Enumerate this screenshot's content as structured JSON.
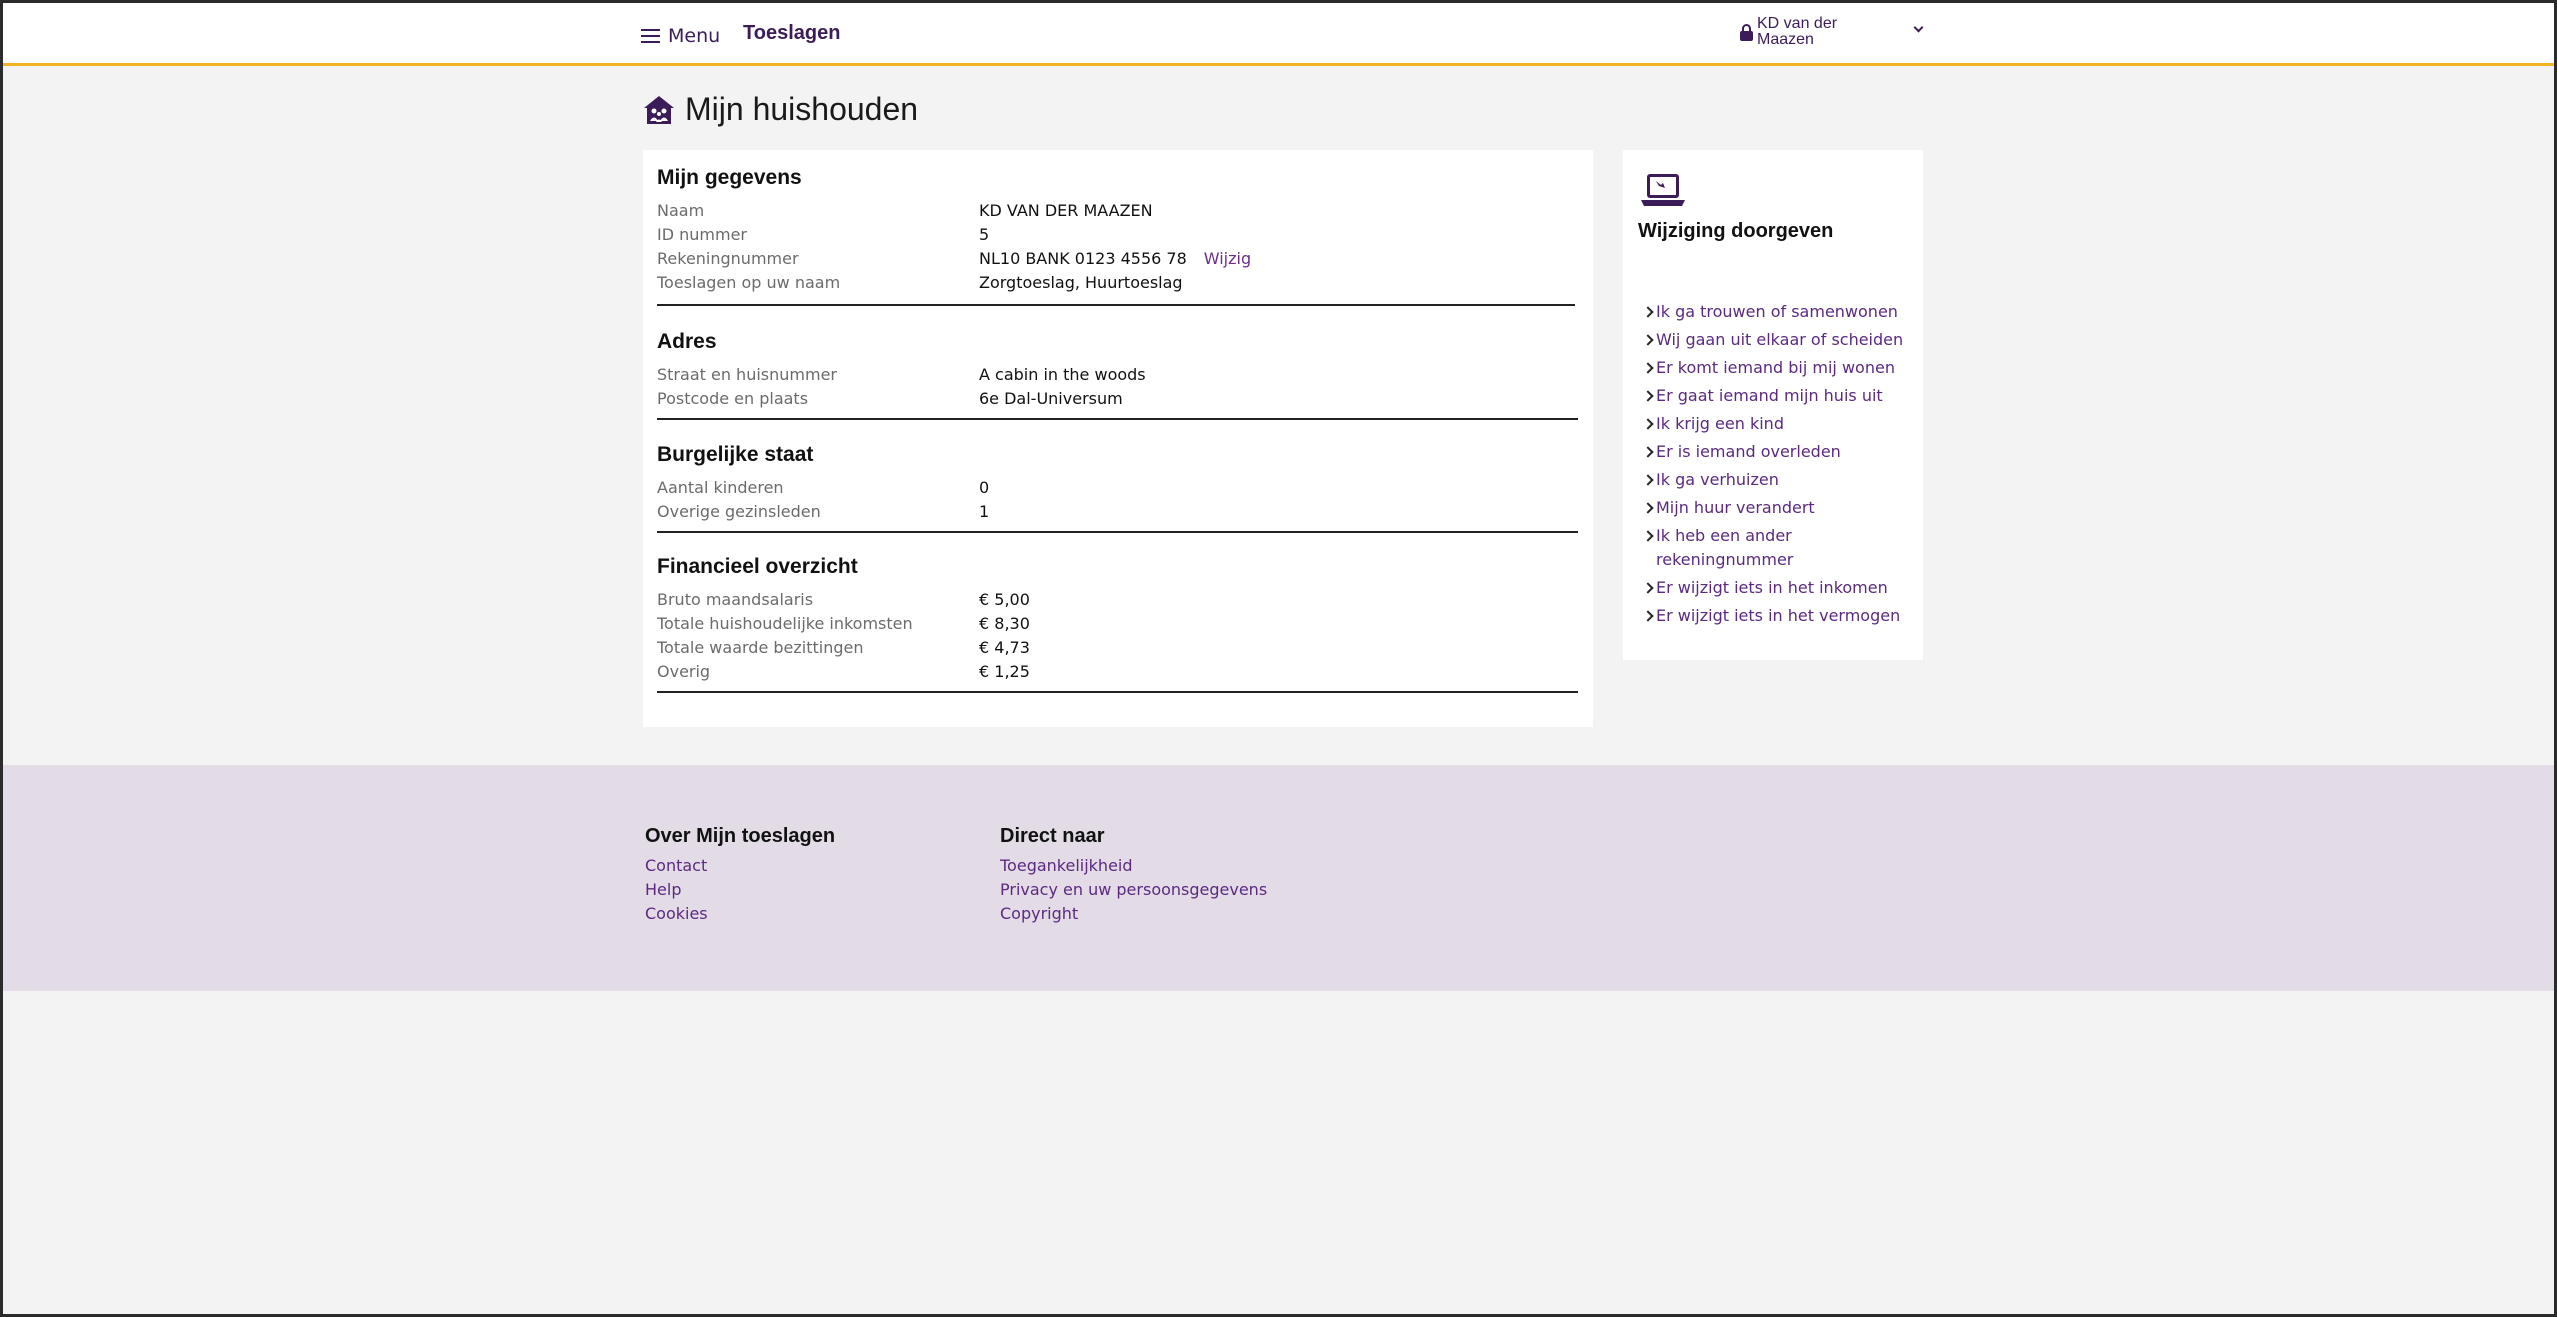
{
  "header": {
    "menu_label": "Menu",
    "brand": "Toeslagen",
    "user_name": "KD van der Maazen"
  },
  "page": {
    "title": "Mijn huishouden"
  },
  "sections": {
    "gegevens": {
      "title": "Mijn gegevens",
      "rows": [
        {
          "label": "Naam",
          "value": "KD VAN DER MAAZEN"
        },
        {
          "label": "ID nummer",
          "value": "5"
        },
        {
          "label": "Rekeningnummer",
          "value": "NL10 BANK 0123 4556 78",
          "action": "Wijzig"
        },
        {
          "label": "Toeslagen op uw naam",
          "value": "Zorgtoeslag, Huurtoeslag"
        }
      ]
    },
    "adres": {
      "title": "Adres",
      "rows": [
        {
          "label": "Straat en huisnummer",
          "value": "A cabin in the woods"
        },
        {
          "label": "Postcode en plaats",
          "value": "6e Dal-Universum"
        }
      ]
    },
    "burgerlijk": {
      "title": "Burgelijke staat",
      "rows": [
        {
          "label": "Aantal kinderen",
          "value": "0"
        },
        {
          "label": "Overige gezinsleden",
          "value": "1"
        }
      ]
    },
    "financieel": {
      "title": "Financieel overzicht",
      "rows": [
        {
          "label": "Bruto maandsalaris",
          "value": "€ 5,00"
        },
        {
          "label": "Totale huishoudelijke inkomsten",
          "value": "€ 8,30"
        },
        {
          "label": "Totale waarde bezittingen",
          "value": "€ 4,73"
        },
        {
          "label": "Overig",
          "value": "€ 1,25"
        }
      ]
    }
  },
  "side": {
    "icon": "laptop-icon",
    "title": "Wijziging doorgeven",
    "links": [
      "Ik ga trouwen of samenwonen",
      "Wij gaan uit elkaar of scheiden",
      "Er komt iemand bij mij wonen",
      "Er gaat iemand mijn huis uit",
      "Ik krijg een kind",
      "Er is iemand overleden",
      "Ik ga verhuizen",
      "Mijn huur verandert",
      "Ik heb een ander rekeningnummer",
      "Er wijzigt iets in het inkomen",
      "Er wijzigt iets in het vermogen"
    ]
  },
  "footer": {
    "col1": {
      "title": "Over Mijn toeslagen",
      "links": [
        "Contact",
        "Help",
        "Cookies"
      ]
    },
    "col2": {
      "title": "Direct naar",
      "links": [
        "Toegankelijkheid",
        "Privacy en uw persoonsgegevens",
        "Copyright"
      ]
    }
  },
  "colors": {
    "accent": "#3c1c58",
    "link": "#5b2a80",
    "header_border": "#f2b324",
    "footer_bg": "#e3dbe6"
  }
}
